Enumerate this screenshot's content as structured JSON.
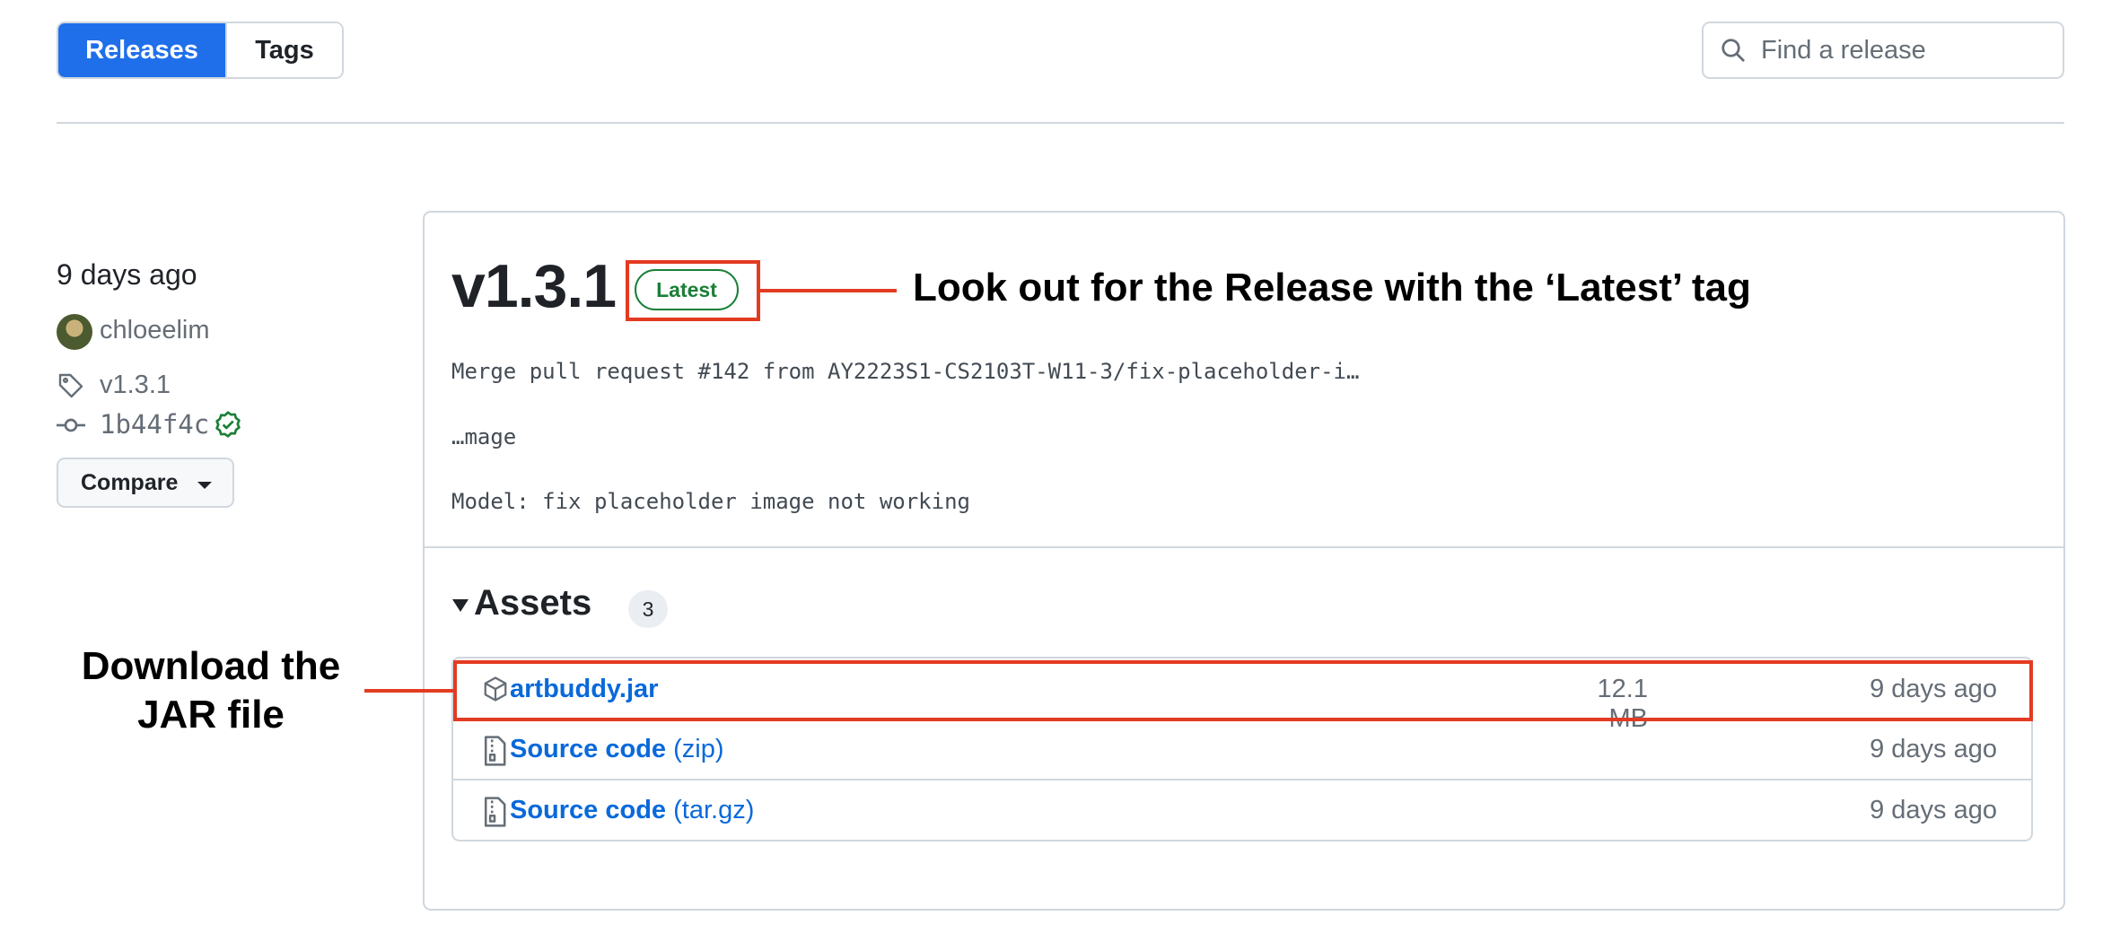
{
  "nav": {
    "tabs": [
      {
        "label": "Releases",
        "active": true
      },
      {
        "label": "Tags",
        "active": false
      }
    ],
    "search_placeholder": "Find a release"
  },
  "release": {
    "date": "9 days ago",
    "author": "chloeelim",
    "tag": "v1.3.1",
    "commit": "1b44f4c",
    "compare_label": "Compare",
    "version": "v1.3.1",
    "badge": "Latest",
    "body": [
      "Merge pull request #142 from AY2223S1-CS2103T-W11-3/fix-placeholder-i…",
      "…mage",
      "Model: fix placeholder image not working"
    ]
  },
  "assets": {
    "title": "Assets",
    "count": "3",
    "items": [
      {
        "name": "artbuddy.jar",
        "suffix": "",
        "size": "12.1 MB",
        "date": "9 days ago",
        "icon": "package-icon"
      },
      {
        "name": "Source code",
        "suffix": "(zip)",
        "size": "",
        "date": "9 days ago",
        "icon": "file-zip-icon"
      },
      {
        "name": "Source code",
        "suffix": "(tar.gz)",
        "size": "",
        "date": "9 days ago",
        "icon": "file-zip-icon"
      }
    ]
  },
  "annotations": {
    "latest_note": "Look out for the Release with the ‘Latest’ tag",
    "download_note_line1": "Download the",
    "download_note_line2": "JAR file",
    "highlight_color": "#e33b22"
  },
  "colors": {
    "accent": "#1f6feb",
    "link": "#0969da",
    "success": "#1a7f37",
    "muted": "#656d76",
    "border": "#d0d7de"
  }
}
